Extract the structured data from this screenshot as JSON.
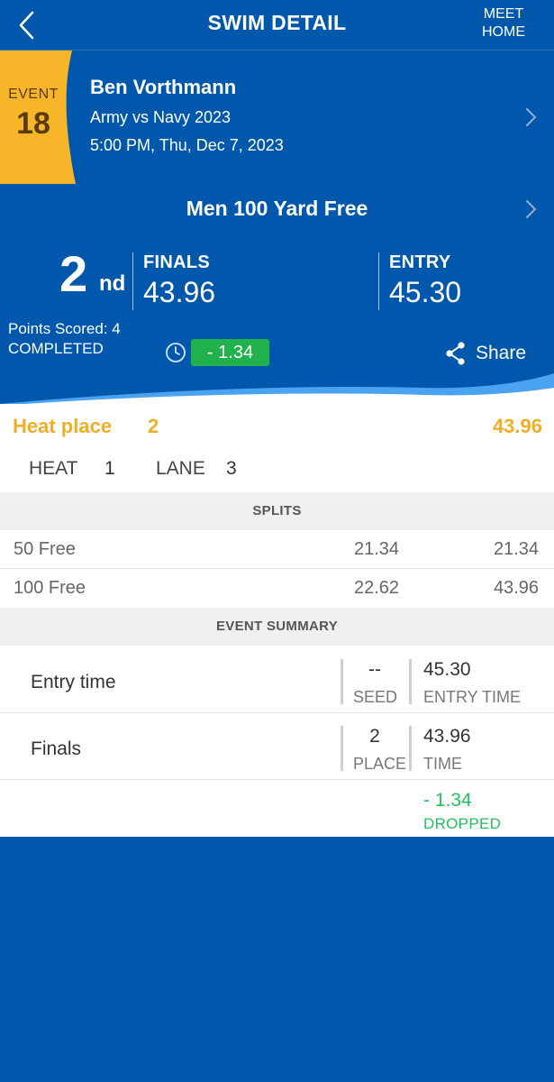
{
  "topbar": {
    "title": "SWIM DETAIL",
    "meet_home_line1": "MEET",
    "meet_home_line2": "HOME"
  },
  "swimmer": {
    "event_label": "EVENT",
    "event_number": "18",
    "name": "Ben Vorthmann",
    "meet": "Army vs Navy 2023",
    "datetime": "5:00 PM, Thu, Dec 7, 2023"
  },
  "result": {
    "event_title": "Men 100 Yard Free",
    "place": "2",
    "place_suffix": "nd",
    "finals_label": "FINALS",
    "finals_time": "43.96",
    "entry_label": "ENTRY",
    "entry_time": "45.30",
    "points": "Points Scored: 4",
    "status": "COMPLETED",
    "delta": "- 1.34",
    "share_label": "Share"
  },
  "heat": {
    "place_label": "Heat place",
    "place_value": "2",
    "time": "43.96",
    "heat_label": "HEAT",
    "heat_value": "1",
    "lane_label": "LANE",
    "lane_value": "3"
  },
  "splits": {
    "header": "SPLITS",
    "rows": [
      {
        "distance": "50 Free",
        "split": "21.34",
        "cumulative": "21.34"
      },
      {
        "distance": "100 Free",
        "split": "22.62",
        "cumulative": "43.96"
      }
    ]
  },
  "summary": {
    "header": "EVENT SUMMARY",
    "rows": [
      {
        "label": "Entry time",
        "mid_value": "--",
        "mid_sub": "SEED",
        "right_value": "45.30",
        "right_sub": "ENTRY TIME"
      },
      {
        "label": "Finals",
        "mid_value": "2",
        "mid_sub": "PLACE",
        "right_value": "43.96",
        "right_sub": "TIME"
      }
    ],
    "dropped_value": "- 1.34",
    "dropped_label": "DROPPED"
  },
  "colors": {
    "primary": "#0058ad",
    "gold": "#f3ad25",
    "green_badge": "#22b24c",
    "green_text": "#22c35e",
    "wave_light": "#4aa3f0"
  },
  "icons": [
    "chevron-left-icon",
    "chevron-right-icon",
    "clock-icon",
    "share-icon"
  ]
}
